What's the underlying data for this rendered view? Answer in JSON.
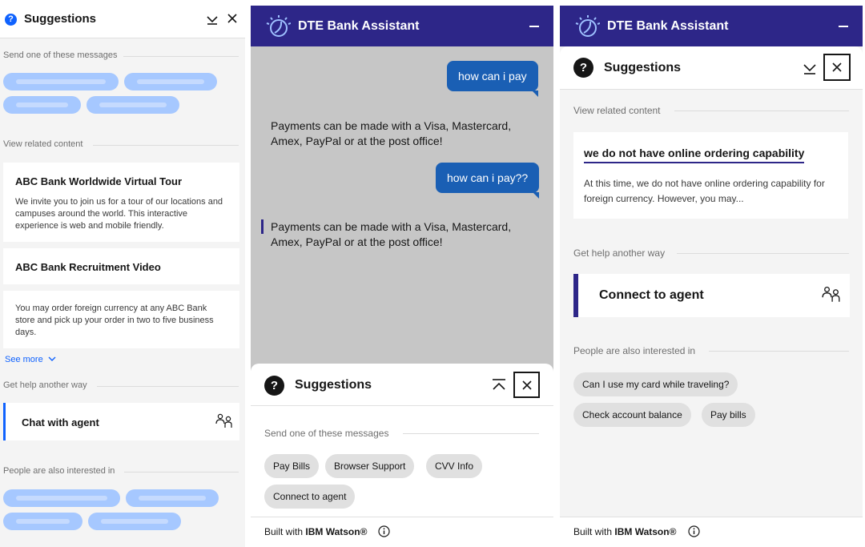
{
  "panel1": {
    "header": {
      "title": "Suggestions"
    },
    "send_label": "Send one of these messages",
    "related_label": "View related content",
    "cards": [
      {
        "title": "ABC Bank Worldwide Virtual Tour",
        "body": "We invite you to join us for a tour of our locations and campuses around the world. This interactive experience is web and mobile friendly."
      },
      {
        "title": "ABC Bank Recruitment Video",
        "body": ""
      },
      {
        "title": "",
        "body": "You may order foreign currency at any ABC Bank store and pick up your order in two to five business days."
      }
    ],
    "see_more": "See more",
    "help_label": "Get help another way",
    "agent_label": "Chat with agent",
    "interested_label": "People are also interested in"
  },
  "panel2": {
    "header": {
      "title": "DTE Bank Assistant"
    },
    "messages": [
      {
        "from": "user",
        "text": "how can i pay"
      },
      {
        "from": "bot",
        "text": "Payments can be made with a Visa, Mastercard, Amex, PayPal or at the post office!"
      },
      {
        "from": "user",
        "text": "how can i pay??"
      },
      {
        "from": "bot",
        "text": "Payments can be made with a Visa, Mastercard, Amex, PayPal or at the post office!"
      }
    ],
    "suggestions": {
      "title": "Suggestions",
      "send_label": "Send one of these messages",
      "chips": [
        "Pay Bills",
        "Browser Support",
        "CVV Info",
        "Connect to agent"
      ]
    },
    "footer": {
      "prefix": "Built with ",
      "brand": "IBM Watson®"
    }
  },
  "panel3": {
    "header": {
      "title": "DTE Bank Assistant"
    },
    "suggestions_title": "Suggestions",
    "related_label": "View related content",
    "card": {
      "title": "we do not have online ordering capability",
      "body": "At this time, we do not have online ordering capability for foreign currency. However, you may..."
    },
    "help_label": "Get help another way",
    "agent_label": "Connect to agent",
    "interested_label": "People are also interested in",
    "chips": [
      "Can I use my card while traveling?",
      "Check account balance",
      "Pay bills"
    ],
    "footer": {
      "prefix": "Built with ",
      "brand": "IBM Watson®"
    }
  },
  "colors": {
    "brand": "#2d2688",
    "bubble": "#1a5fb4",
    "accent": "#0f62fe",
    "placeholder_pill": "#a6c8ff"
  }
}
